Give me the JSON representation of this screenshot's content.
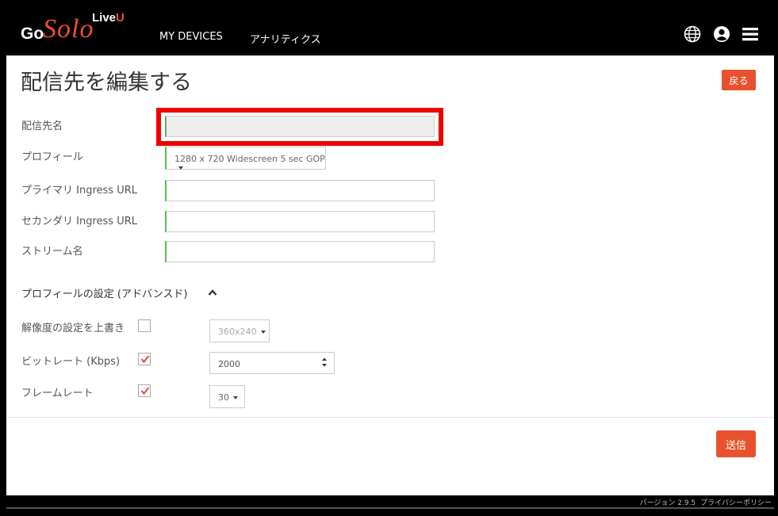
{
  "header": {
    "logo": {
      "go": "Go",
      "solo": "Solo",
      "live": "Live",
      "u": "U"
    },
    "nav": [
      {
        "label": "MY DEVICES"
      },
      {
        "label": "アナリティクス"
      }
    ],
    "icons": [
      "globe-icon",
      "user-icon",
      "menu-icon"
    ]
  },
  "page": {
    "title": "配信先を編集する",
    "back_label": "戻る"
  },
  "form": {
    "name_label": "配信先名",
    "name_value": "",
    "profile_label": "プロフィール",
    "profile_value": "1280 x 720 Widescreen 5 sec GOP",
    "primary_label": "プライマリ Ingress URL",
    "primary_value": "",
    "secondary_label": "セカンダリ Ingress URL",
    "secondary_value": "",
    "stream_label": "ストリーム名",
    "stream_value": ""
  },
  "advanced": {
    "title": "プロフィールの設定 (アドバンスド)",
    "resolution": {
      "label": "解像度の設定を上書き",
      "checked": false,
      "value": "360x240"
    },
    "bitrate": {
      "label": "ビットレート (Kbps)",
      "checked": true,
      "value": "2000"
    },
    "framerate": {
      "label": "フレームレート",
      "checked": true,
      "value": "30"
    }
  },
  "submit_label": "送信",
  "footer": {
    "version": "バージョン 2.9.5",
    "privacy": "プライバシーポリシー"
  },
  "colors": {
    "accent": "#e8512d",
    "valid": "#5cb85c",
    "highlight": "#ee0000",
    "check": "#d9534f"
  }
}
